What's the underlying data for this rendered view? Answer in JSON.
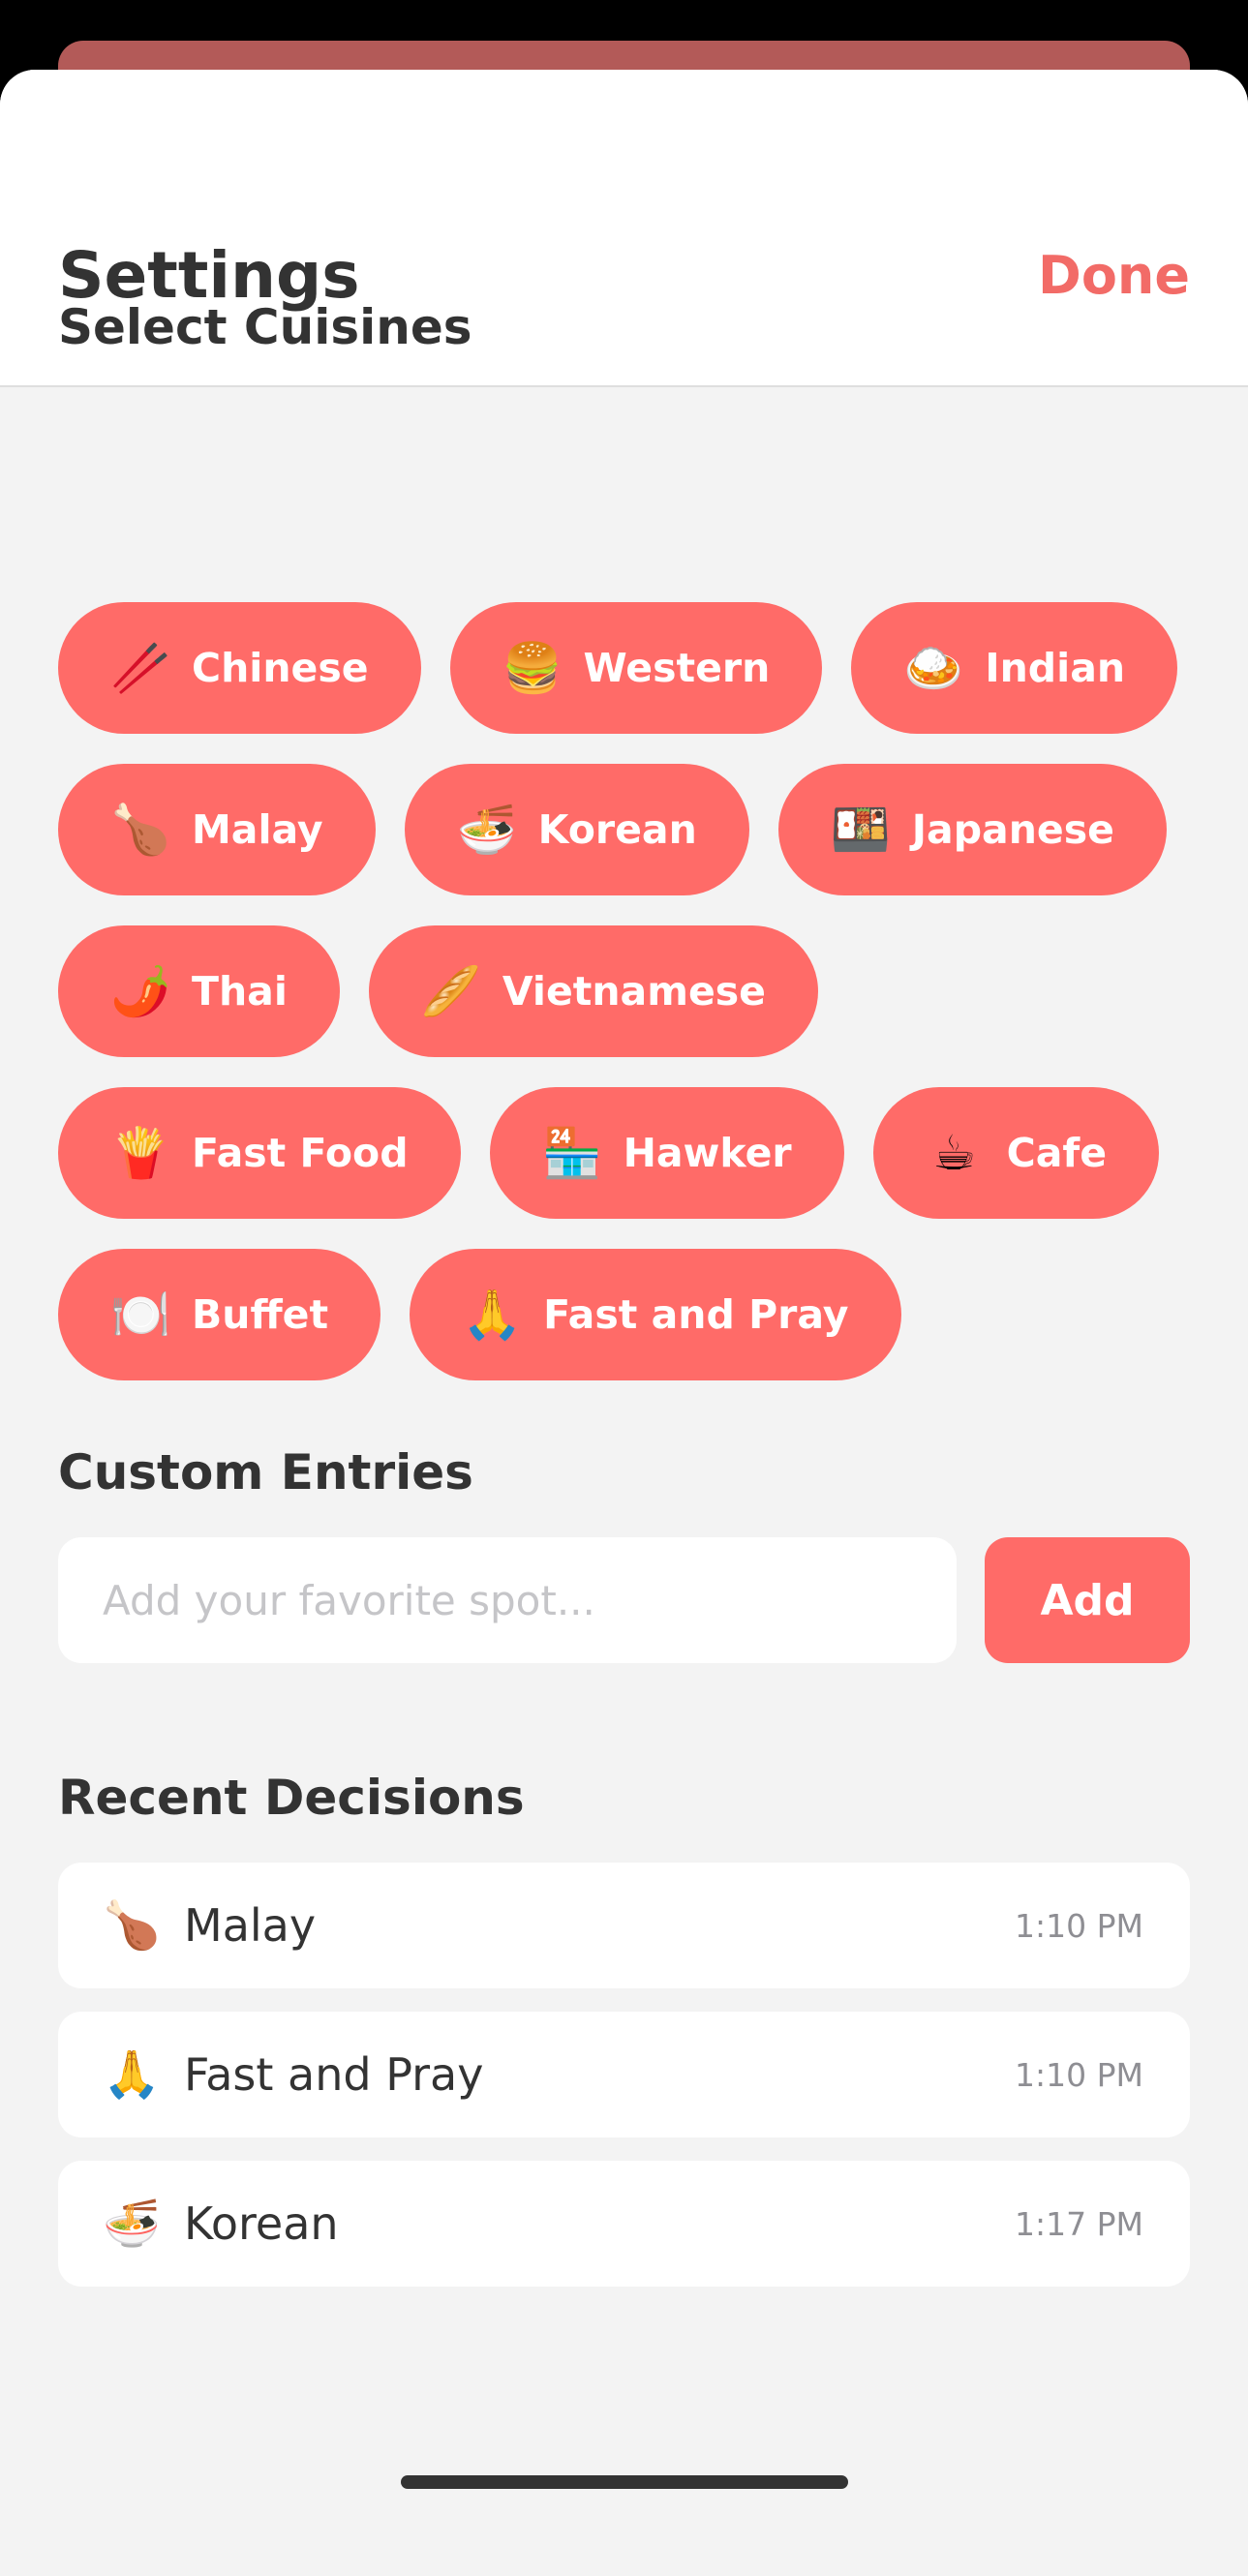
{
  "header": {
    "title": "Settings",
    "done_label": "Done"
  },
  "cuisines": {
    "heading": "Select Cuisines",
    "rows": [
      [
        {
          "icon": "🥢",
          "icon_name": "chopsticks-icon",
          "label": "Chinese"
        },
        {
          "icon": "🍔",
          "icon_name": "burger-icon",
          "label": "Western"
        },
        {
          "icon": "🍛",
          "icon_name": "curry-rice-icon",
          "label": "Indian"
        }
      ],
      [
        {
          "icon": "🍗",
          "icon_name": "chicken-leg-icon",
          "label": "Malay"
        },
        {
          "icon": "🍜",
          "icon_name": "noodle-bowl-icon",
          "label": "Korean"
        },
        {
          "icon": "🍱",
          "icon_name": "bento-box-icon",
          "label": "Japanese"
        }
      ],
      [
        {
          "icon": "🌶️",
          "icon_name": "chili-pepper-icon",
          "label": "Thai"
        },
        {
          "icon": "🥖",
          "icon_name": "baguette-icon",
          "label": "Vietnamese"
        }
      ],
      [
        {
          "icon": "🍟",
          "icon_name": "french-fries-icon",
          "label": "Fast Food"
        },
        {
          "icon": "🏪",
          "icon_name": "convenience-store-icon",
          "label": "Hawker"
        },
        {
          "icon": "☕",
          "icon_name": "coffee-cup-icon",
          "label": "Cafe"
        }
      ],
      [
        {
          "icon": "🍽️",
          "icon_name": "plate-cutlery-icon",
          "label": "Buffet"
        },
        {
          "icon": "🙏",
          "icon_name": "praying-hands-icon",
          "label": "Fast and Pray"
        }
      ]
    ]
  },
  "custom_entries": {
    "heading": "Custom Entries",
    "input_placeholder": "Add your favorite spot...",
    "input_value": "",
    "add_label": "Add"
  },
  "recent_decisions": {
    "heading": "Recent Decisions",
    "items": [
      {
        "icon": "🍗",
        "icon_name": "chicken-leg-icon",
        "label": "Malay",
        "time": "1:10 PM"
      },
      {
        "icon": "🙏",
        "icon_name": "praying-hands-icon",
        "label": "Fast and Pray",
        "time": "1:10 PM"
      },
      {
        "icon": "🍜",
        "icon_name": "noodle-bowl-icon",
        "label": "Korean",
        "time": "1:17 PM"
      }
    ]
  },
  "colors": {
    "accent": "#ff6b68",
    "done_text": "#f26b67",
    "backdrop_card": "#b35a58",
    "background": "#f3f3f3",
    "text": "#333333",
    "muted_text": "#8e8e93"
  }
}
